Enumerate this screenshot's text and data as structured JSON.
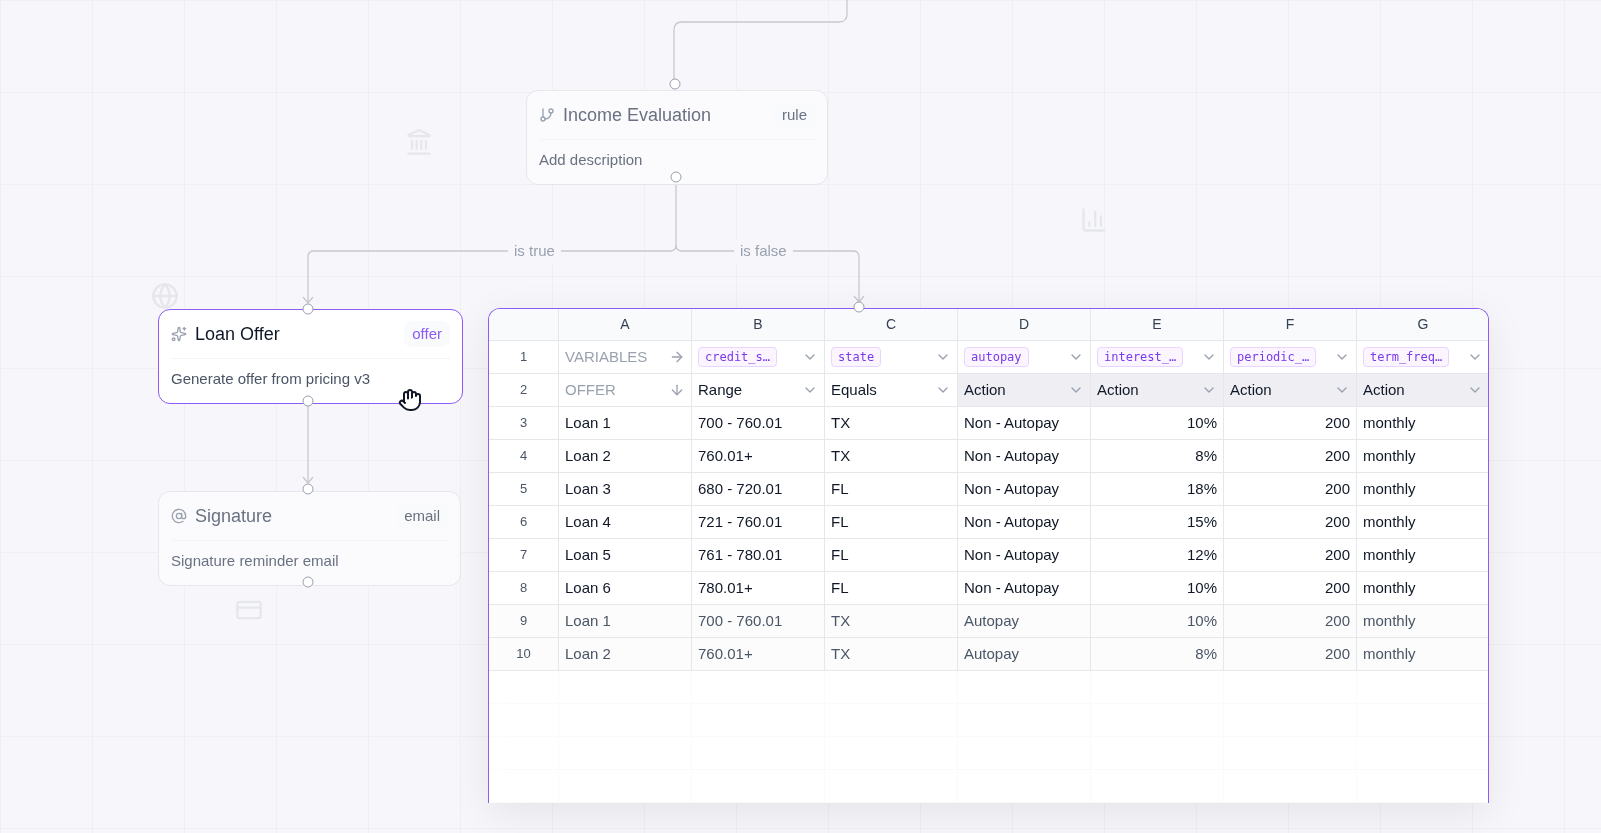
{
  "nodes": [
    {
      "kind": "rule",
      "title": "Income Evaluation",
      "tag": "rule",
      "placeholder": "Add description",
      "faded": true,
      "selected": false
    },
    {
      "kind": "offer",
      "title": "Loan Offer",
      "tag": "offer",
      "description": "Generate offer from pricing v3",
      "faded": false,
      "selected": true
    },
    {
      "kind": "email",
      "title": "Signature",
      "tag": "email",
      "description": "Signature reminder email",
      "faded": true,
      "selected": false
    }
  ],
  "edges": [
    {
      "label": "is true"
    },
    {
      "label": "is false"
    }
  ],
  "table": {
    "selected": true,
    "columns": [
      {
        "label": "A",
        "kind": "text"
      },
      {
        "label": "B",
        "kind": "text"
      },
      {
        "label": "C",
        "kind": "text"
      },
      {
        "label": "D",
        "kind": "text"
      },
      {
        "label": "E",
        "kind": "number"
      },
      {
        "label": "F",
        "kind": "number"
      },
      {
        "label": "G",
        "kind": "text"
      }
    ],
    "rows": [
      {
        "number": "1",
        "kind": "variables",
        "label": "VARIABLES",
        "cells": [
          "credit_s…",
          "state",
          "autopay",
          "interest_…",
          "periodic_…",
          "term_freq…"
        ]
      },
      {
        "number": "2",
        "kind": "operators",
        "label": "OFFER",
        "cells": [
          {
            "text": "Range",
            "shaded": false
          },
          {
            "text": "Equals",
            "shaded": false
          },
          {
            "text": "Action",
            "shaded": true
          },
          {
            "text": "Action",
            "shaded": true
          },
          {
            "text": "Action",
            "shaded": true
          },
          {
            "text": "Action",
            "shaded": true
          }
        ]
      },
      {
        "number": "3",
        "kind": "data",
        "blurred": false,
        "cells": [
          "Loan 1",
          "700 - 760.01",
          "TX",
          "Non - Autopay",
          "10%",
          "200",
          "monthly"
        ]
      },
      {
        "number": "4",
        "kind": "data",
        "blurred": false,
        "cells": [
          "Loan 2",
          "760.01+",
          "TX",
          "Non - Autopay",
          "8%",
          "200",
          "monthly"
        ]
      },
      {
        "number": "5",
        "kind": "data",
        "blurred": false,
        "cells": [
          "Loan 3",
          "680 - 720.01",
          "FL",
          "Non - Autopay",
          "18%",
          "200",
          "monthly"
        ]
      },
      {
        "number": "6",
        "kind": "data",
        "blurred": false,
        "cells": [
          "Loan 4",
          "721 - 760.01",
          "FL",
          "Non - Autopay",
          "15%",
          "200",
          "monthly"
        ]
      },
      {
        "number": "7",
        "kind": "data",
        "blurred": false,
        "cells": [
          "Loan 5",
          "761 - 780.01",
          "FL",
          "Non - Autopay",
          "12%",
          "200",
          "monthly"
        ]
      },
      {
        "number": "8",
        "kind": "data",
        "blurred": false,
        "cells": [
          "Loan 6",
          "780.01+",
          "FL",
          "Non - Autopay",
          "10%",
          "200",
          "monthly"
        ]
      },
      {
        "number": "9",
        "kind": "data",
        "blurred": true,
        "cells": [
          "Loan 1",
          "700 - 760.01",
          "TX",
          "Autopay",
          "10%",
          "200",
          "monthly"
        ]
      },
      {
        "number": "10",
        "kind": "data",
        "blurred": true,
        "cells": [
          "Loan 2",
          "760.01+",
          "TX",
          "Autopay",
          "8%",
          "200",
          "monthly"
        ]
      }
    ]
  }
}
